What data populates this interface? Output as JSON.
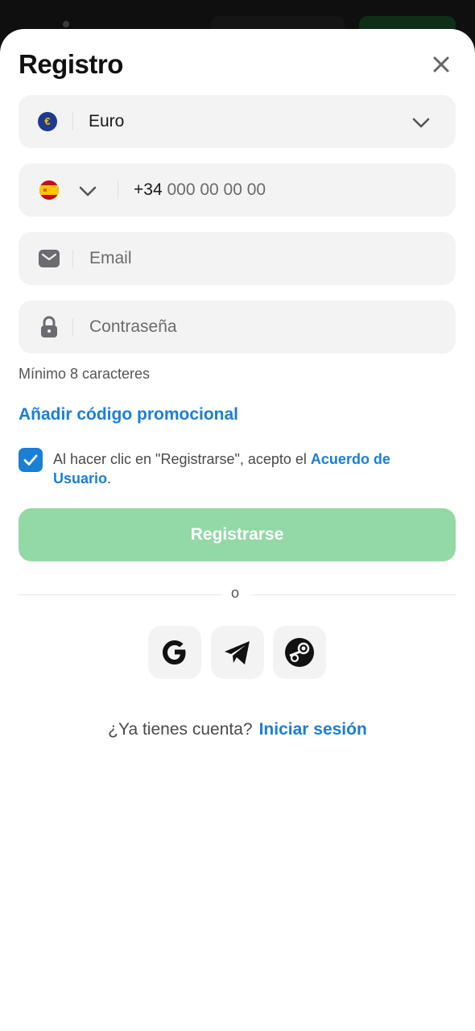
{
  "modal": {
    "title": "Registro",
    "close_icon": "close-icon"
  },
  "currency": {
    "symbol": "€",
    "value": "Euro",
    "icon": "euro-icon"
  },
  "phone": {
    "country_code": "+34",
    "placeholder": "000 00 00 00",
    "flag_icon": "spain-flag-icon"
  },
  "email": {
    "placeholder": "Email",
    "icon": "envelope-icon"
  },
  "password": {
    "placeholder": "Contraseña",
    "icon": "lock-icon",
    "hint": "Mínimo 8 caracteres"
  },
  "promo": {
    "label": "Añadir código promocional"
  },
  "terms": {
    "checked": true,
    "text_before": "Al hacer clic en \"Registrarse\", acepto el ",
    "link": "Acuerdo de Usuario",
    "text_after": "."
  },
  "submit": {
    "label": "Registrarse"
  },
  "divider": {
    "text": "o"
  },
  "social": [
    {
      "name": "google",
      "icon": "google-icon"
    },
    {
      "name": "telegram",
      "icon": "telegram-icon"
    },
    {
      "name": "steam",
      "icon": "steam-icon"
    }
  ],
  "login": {
    "question": "¿Ya tienes cuenta?",
    "link": "Iniciar sesión"
  },
  "colors": {
    "accent": "#1a7fd6",
    "submit_disabled": "#93d9a5",
    "field_bg": "#f3f3f4"
  }
}
